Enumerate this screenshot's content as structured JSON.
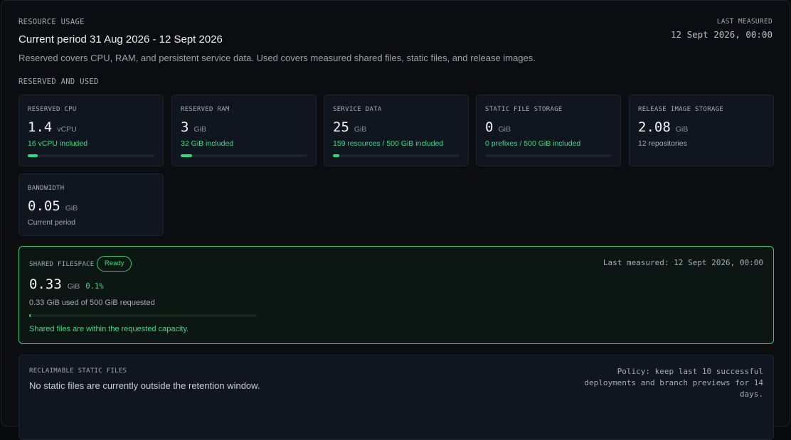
{
  "header": {
    "eyebrow": "RESOURCE USAGE",
    "period": "Current period 31 Aug 2026 - 12 Sept 2026",
    "description": "Reserved covers CPU, RAM, and persistent service data. Used covers measured shared files, static files, and release images.",
    "last_measured_label": "LAST MEASURED",
    "last_measured_value": "12 Sept 2026, 00:00"
  },
  "section_title": "RESERVED AND USED",
  "cards": [
    {
      "label": "RESERVED CPU",
      "value": "1.4",
      "unit": "vCPU",
      "note": "16 vCPU included",
      "progress": 0.08
    },
    {
      "label": "RESERVED RAM",
      "value": "3",
      "unit": "GiB",
      "note": "32 GiB included",
      "progress": 0.09
    },
    {
      "label": "SERVICE DATA",
      "value": "25",
      "unit": "GiB",
      "note": "159 resources / 500 GiB included",
      "progress": 0.05
    },
    {
      "label": "STATIC FILE STORAGE",
      "value": "0",
      "unit": "GiB",
      "note": "0 prefixes / 500 GiB included",
      "progress": 0
    },
    {
      "label": "RELEASE IMAGE STORAGE",
      "value": "2.08",
      "unit": "GiB",
      "note": "12 repositories"
    },
    {
      "label": "BANDWIDTH",
      "value": "0.05",
      "unit": "GiB",
      "note": "Current period"
    }
  ],
  "shared": {
    "label": "SHARED FILESPACE",
    "badge": "Ready",
    "last_measured": "Last measured: 12 Sept 2026, 00:00",
    "value": "0.33",
    "unit": "GiB",
    "percent": "0.1%",
    "used_text": "0.33 GiB used of 500 GiB requested",
    "progress": 0.001,
    "status": "Shared files are within the requested capacity."
  },
  "reclaim": {
    "label": "RECLAIMABLE STATIC FILES",
    "message": "No static files are currently outside the retention window.",
    "policy": "Policy: keep last 10 successful deployments and branch previews for 14 days."
  },
  "colors": {
    "accent": "#22e07a",
    "accent_text": "#3ddc84",
    "card_bg": "#0f1620",
    "page_bg": "#0b0d10"
  }
}
